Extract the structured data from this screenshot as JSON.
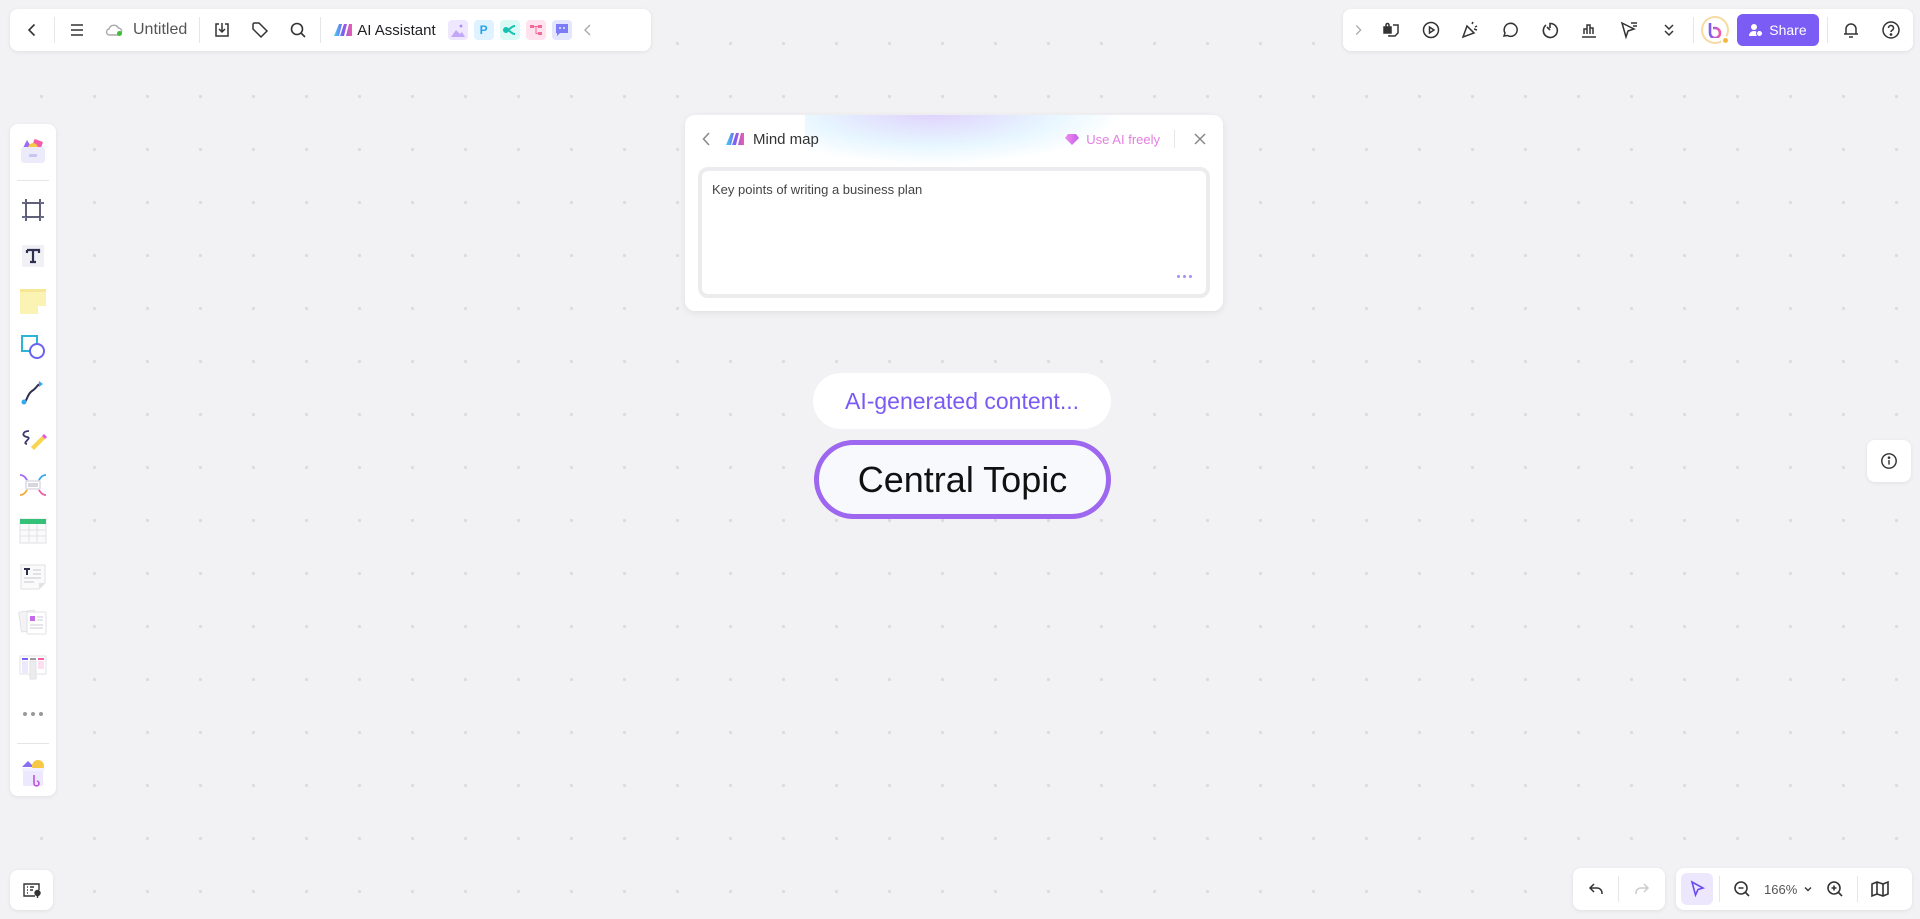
{
  "top_left": {
    "document_title": "Untitled",
    "sync_status": "saved",
    "ai_assistant_label": "AI Assistant",
    "tools": [
      {
        "name": "ai-image",
        "color": "#b69bf5",
        "bg": "#efe6ff"
      },
      {
        "name": "ai-presentation",
        "glyph": "P",
        "color": "#2aa3e8",
        "bg": "#dff2ff"
      },
      {
        "name": "ai-mindmap",
        "color": "#16c2b0",
        "bg": "#dcfaf5"
      },
      {
        "name": "ai-flowchart",
        "color": "#f06a9a",
        "bg": "#ffe2ee"
      },
      {
        "name": "ai-chat",
        "color": "#7b7cf5",
        "bg": "#e4e5ff"
      }
    ]
  },
  "top_right": {
    "share_label": "Share",
    "accent": "#7b5cf5"
  },
  "mindmap_panel": {
    "title": "Mind map",
    "use_ai_label": "Use AI freely",
    "prompt_text": "Key points of writing a business plan"
  },
  "canvas": {
    "generating_label": "AI-generated content...",
    "central_topic": "Central Topic",
    "topic_border_color": "#9d67ef"
  },
  "bottom_right": {
    "zoom_level": "166%"
  }
}
